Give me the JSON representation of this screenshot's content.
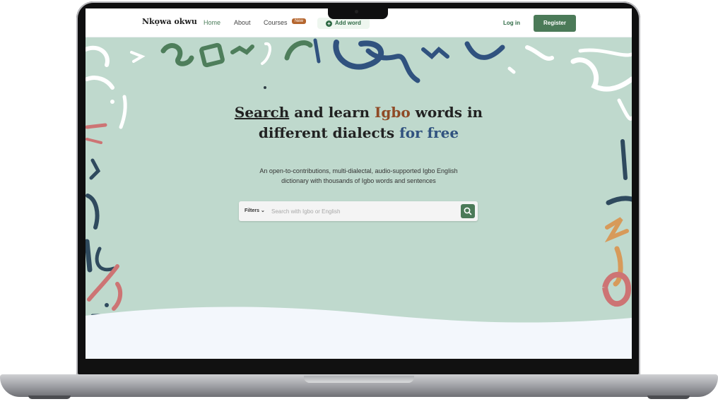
{
  "nav": {
    "logo": "Nkọwa okwu",
    "home": "Home",
    "about": "About",
    "courses": "Courses",
    "courses_badge": "New",
    "add_word": "Add word",
    "login": "Log in",
    "register": "Register"
  },
  "hero": {
    "headline_search": "Search",
    "headline_and_learn": " and learn ",
    "headline_igbo": "Igbo",
    "headline_words_in": " words in",
    "headline_line2": "different dialects ",
    "headline_free": "for free",
    "subtitle_line1": "An open-to-contributions, multi-dialectal, audio-supported Igbo English",
    "subtitle_line2": "dictionary with thousands of Igbo words and sentences"
  },
  "search": {
    "filters_label": "Filters",
    "placeholder": "Search with Igbo or English"
  },
  "colors": {
    "brand_green": "#4b7a58",
    "hero_bg": "#bfd9cd",
    "igbo_accent": "#8f4a26",
    "free_accent": "#30527f",
    "badge": "#b5662f"
  }
}
